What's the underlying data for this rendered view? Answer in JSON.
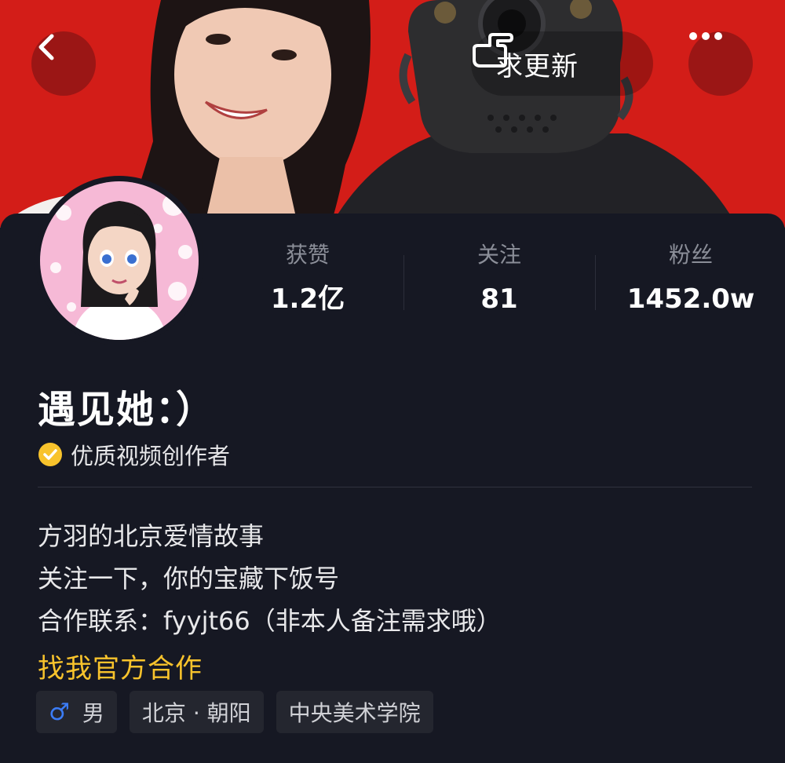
{
  "header": {
    "back_icon": "chevron-left-icon",
    "remind_label": "求更新",
    "remind_icon": "pointing-hand-icon",
    "more_icon": "more-dots-icon"
  },
  "profile": {
    "name": "遇见她：）",
    "badge": {
      "icon": "verified-check-icon",
      "label": "优质视频创作者",
      "color": "#f8c32c"
    }
  },
  "stats": [
    {
      "label": "获赞",
      "value": "1.2亿"
    },
    {
      "label": "关注",
      "value": "81"
    },
    {
      "label": "粉丝",
      "value": "1452.0w"
    }
  ],
  "bio": {
    "lines": [
      "方羽的北京爱情故事",
      "关注一下，你的宝藏下饭号",
      "合作联系：fyyjt66（非本人备注需求哦）"
    ]
  },
  "cooperation_link": "找我官方合作",
  "tags": {
    "gender": {
      "icon": "male-icon",
      "label": "男"
    },
    "location": "北京 · 朝阳",
    "school": "中央美术学院"
  },
  "colors": {
    "banner": "#d31d18",
    "panel": "#161823",
    "accent_yellow": "#f8c32c",
    "male_blue": "#3b7cf6"
  }
}
